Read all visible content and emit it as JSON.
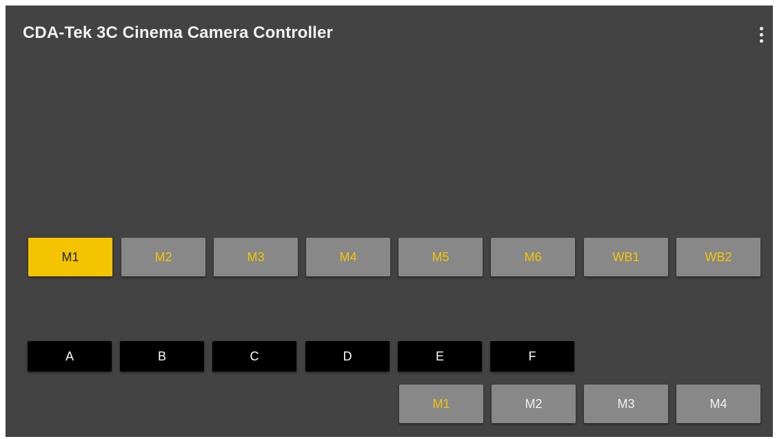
{
  "appbar": {
    "title": "CDA-Tek 3C Cinema Camera Controller",
    "menu_icon": "more-vert-icon"
  },
  "colors": {
    "background": "#434343",
    "accent": "#f5c400",
    "button_gray": "#888888",
    "camera_button": "#000000"
  },
  "memory_buttons": [
    {
      "label": "M1",
      "active": true
    },
    {
      "label": "M2",
      "active": false
    },
    {
      "label": "M3",
      "active": false
    },
    {
      "label": "M4",
      "active": false
    },
    {
      "label": "M5",
      "active": false
    },
    {
      "label": "M6",
      "active": false
    },
    {
      "label": "WB1",
      "active": false
    },
    {
      "label": "WB2",
      "active": false
    }
  ],
  "camera_buttons": [
    {
      "label": "A"
    },
    {
      "label": "B"
    },
    {
      "label": "C"
    },
    {
      "label": "D"
    },
    {
      "label": "E"
    },
    {
      "label": "F"
    }
  ],
  "bank_buttons": [
    {
      "label": "M1",
      "selected": true
    },
    {
      "label": "M2",
      "selected": false
    },
    {
      "label": "M3",
      "selected": false
    },
    {
      "label": "M4",
      "selected": false
    }
  ]
}
